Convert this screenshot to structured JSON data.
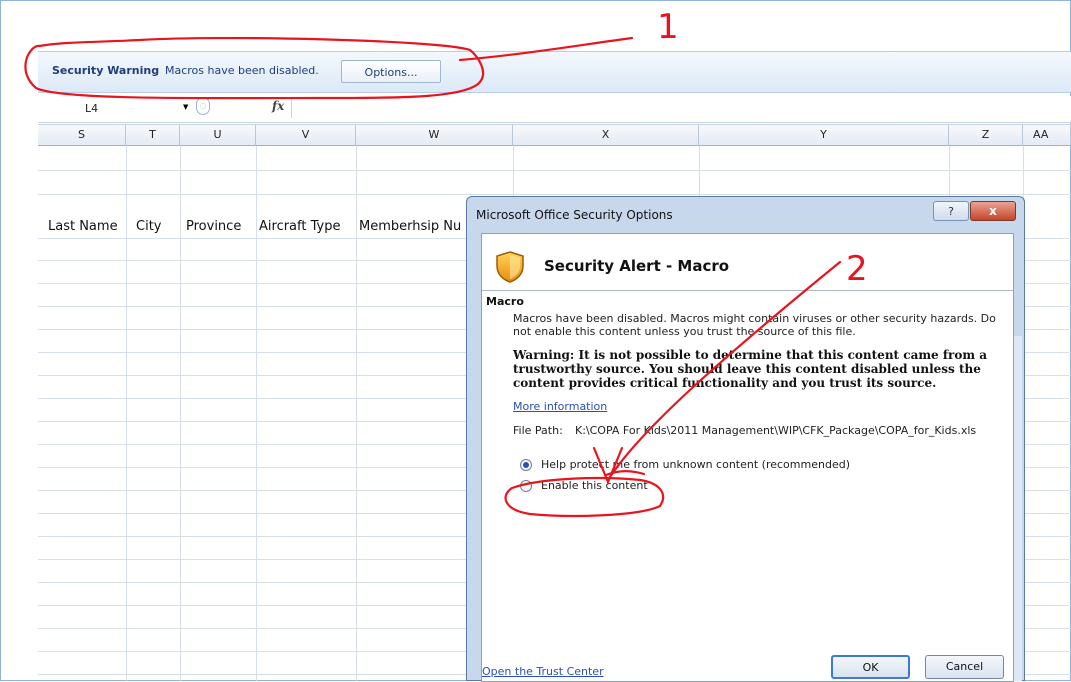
{
  "security_bar": {
    "title": "Security Warning",
    "message": "Macros have been disabled.",
    "options_button": "Options..."
  },
  "formula_bar": {
    "name_box": "L4",
    "fx_label": "fx"
  },
  "columns": [
    "S",
    "T",
    "U",
    "V",
    "W",
    "X",
    "Y",
    "Z",
    "AA"
  ],
  "header_row": [
    "Last Name",
    "City",
    "Province",
    "Aircraft Type",
    "Memberhsip Nu"
  ],
  "annotations": [
    "1",
    "2"
  ],
  "dialog": {
    "window_title": "Microsoft Office Security Options",
    "help_button": "?",
    "close_button": "x",
    "heading": "Security Alert - Macro",
    "group_label": "Macro",
    "description": "Macros have been disabled. Macros might contain viruses or other security hazards. Do not enable this content unless you trust the source of this file.",
    "warning": "Warning: It is not possible to determine that this content came from a trustworthy source. You should leave this content disabled unless the content provides critical functionality and you trust its source.",
    "more_info": "More information",
    "file_path_label": "File Path:",
    "file_path_value": "K:\\COPA For Kids\\2011 Management\\WIP\\CFK_Package\\COPA_for_Kids.xls",
    "options": [
      {
        "label": "Help protect me from unknown content (recommended)",
        "selected": true
      },
      {
        "label": "Enable this content",
        "selected": false
      }
    ],
    "trust_center_link": "Open the Trust Center",
    "ok_button": "OK",
    "cancel_button": "Cancel"
  },
  "colors": {
    "accent_blue": "#2a4fb8",
    "title_bar": "#c8d8ec",
    "annotation_red": "#e8141e"
  }
}
